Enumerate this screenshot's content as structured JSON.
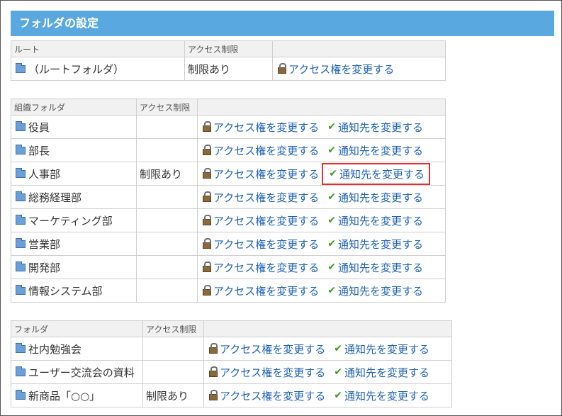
{
  "title": "フォルダの設定",
  "root_table": {
    "headers": [
      "ルート",
      "アクセス制限",
      ""
    ],
    "rows": [
      {
        "name": "（ルートフォルダ）",
        "restriction": "制限あり",
        "access_link": "アクセス権を変更する"
      }
    ]
  },
  "org_table": {
    "headers": [
      "組織フォルダ",
      "アクセス制限",
      ""
    ],
    "rows": [
      {
        "name": "役員",
        "restriction": "",
        "access_link": "アクセス権を変更する",
        "notify_link": "通知先を変更する"
      },
      {
        "name": "部長",
        "restriction": "",
        "access_link": "アクセス権を変更する",
        "notify_link": "通知先を変更する"
      },
      {
        "name": "人事部",
        "restriction": "制限あり",
        "access_link": "アクセス権を変更する",
        "notify_link": "通知先を変更する"
      },
      {
        "name": "総務経理部",
        "restriction": "",
        "access_link": "アクセス権を変更する",
        "notify_link": "通知先を変更する"
      },
      {
        "name": "マーケティング部",
        "restriction": "",
        "access_link": "アクセス権を変更する",
        "notify_link": "通知先を変更する"
      },
      {
        "name": "営業部",
        "restriction": "",
        "access_link": "アクセス権を変更する",
        "notify_link": "通知先を変更する"
      },
      {
        "name": "開発部",
        "restriction": "",
        "access_link": "アクセス権を変更する",
        "notify_link": "通知先を変更する"
      },
      {
        "name": "情報システム部",
        "restriction": "",
        "access_link": "アクセス権を変更する",
        "notify_link": "通知先を変更する"
      }
    ]
  },
  "folder_table": {
    "headers": [
      "フォルダ",
      "アクセス制限",
      ""
    ],
    "rows": [
      {
        "name": "社内勉強会",
        "restriction": "",
        "access_link": "アクセス権を変更する",
        "notify_link": "通知先を変更する"
      },
      {
        "name": "ユーザー交流会の資料",
        "restriction": "",
        "access_link": "アクセス権を変更する",
        "notify_link": "通知先を変更する"
      },
      {
        "name": "新商品「○○」",
        "restriction": "制限あり",
        "access_link": "アクセス権を変更する",
        "notify_link": "通知先を変更する"
      }
    ]
  },
  "icons": {
    "folder": "folder-icon",
    "lock": "lock-icon",
    "check": "check-icon"
  },
  "colors": {
    "title_bar": "#5aa8e0",
    "link": "#1f62b5",
    "highlight": "#e03030",
    "check": "#3c9a1e"
  }
}
